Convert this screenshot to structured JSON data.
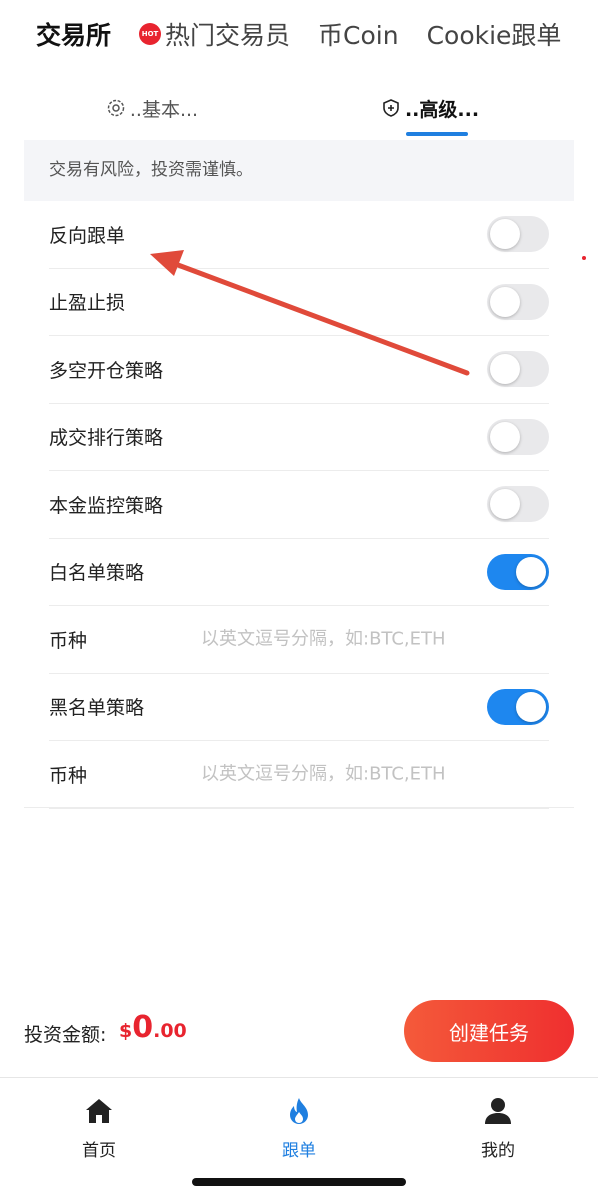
{
  "top_tabs": [
    {
      "label": "交易所",
      "active": true
    },
    {
      "label": "热门交易员",
      "badge": "HOT"
    },
    {
      "label": "币Coin"
    },
    {
      "label": "Cookie跟单"
    }
  ],
  "sub_tabs": [
    {
      "label": "..基本...",
      "icon": "gear-icon"
    },
    {
      "label": "..高级...",
      "icon": "shield-plus-icon",
      "active": true
    }
  ],
  "notice": "交易有风险，投资需谨慎。",
  "settings": [
    {
      "label": "反向跟单",
      "enabled": false
    },
    {
      "label": "止盈止损",
      "enabled": false
    },
    {
      "label": "多空开仓策略",
      "enabled": false
    },
    {
      "label": "成交排行策略",
      "enabled": false
    },
    {
      "label": "本金监控策略",
      "enabled": false
    },
    {
      "label": "白名单策略",
      "enabled": true
    },
    {
      "label": "币种",
      "placeholder": "以英文逗号分隔，如:BTC,ETH"
    },
    {
      "label": "黑名单策略",
      "enabled": true
    },
    {
      "label": "币种",
      "placeholder": "以英文逗号分隔，如:BTC,ETH"
    }
  ],
  "invest": {
    "label": "投资金额:",
    "currency": "$",
    "amount_int": "0",
    "amount_dec": ".00",
    "button": "创建任务"
  },
  "bottom_nav": [
    {
      "label": "首页",
      "icon": "home-icon"
    },
    {
      "label": "跟单",
      "icon": "flame-icon",
      "active": true
    },
    {
      "label": "我的",
      "icon": "user-icon"
    }
  ],
  "colors": {
    "accent": "#1f7fe0",
    "toggle_on": "#1e87ef",
    "danger": "#e8242f",
    "arrow": "#e04a3a"
  }
}
